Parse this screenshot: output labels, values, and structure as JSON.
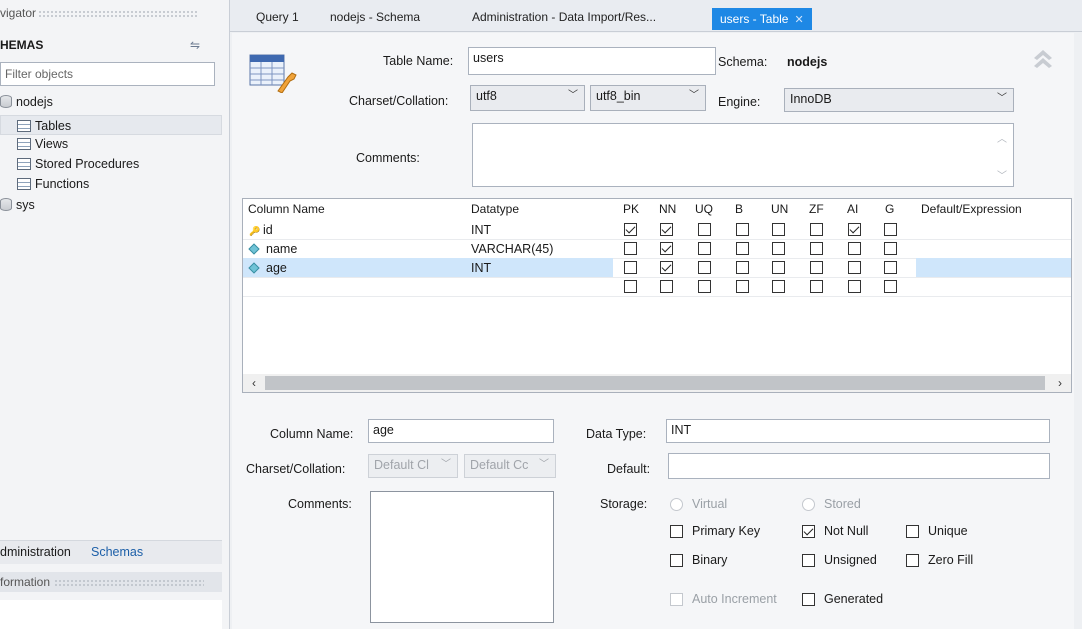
{
  "navigator": {
    "header": "vigator",
    "schemas_title": "HEMAS",
    "filter_placeholder": "Filter objects",
    "tree": [
      {
        "label": "nodejs",
        "type": "db"
      },
      {
        "label": "Tables",
        "type": "table"
      },
      {
        "label": "Views",
        "type": "table"
      },
      {
        "label": "Stored Procedures",
        "type": "table"
      },
      {
        "label": "Functions",
        "type": "table"
      },
      {
        "label": "sys",
        "type": "db"
      }
    ],
    "bottom_tabs": [
      "dministration",
      "Schemas"
    ],
    "info_header": "formation"
  },
  "tabs": [
    {
      "label": "Query 1"
    },
    {
      "label": "nodejs - Schema"
    },
    {
      "label": "Administration - Data Import/Res..."
    },
    {
      "label": "users - Table"
    }
  ],
  "table_editor": {
    "table_name_label": "Table Name:",
    "table_name_value": "users",
    "schema_label": "Schema:",
    "schema_value": "nodejs",
    "charset_label": "Charset/Collation:",
    "charset_value": "utf8",
    "collation_value": "utf8_bin",
    "engine_label": "Engine:",
    "engine_value": "InnoDB",
    "comments_label": "Comments:"
  },
  "columns_grid": {
    "headers": [
      "Column Name",
      "Datatype",
      "PK",
      "NN",
      "UQ",
      "B",
      "UN",
      "ZF",
      "AI",
      "G",
      "Default/Expression"
    ],
    "rows": [
      {
        "name": "id",
        "datatype": "INT",
        "flags": [
          true,
          true,
          false,
          false,
          false,
          false,
          true,
          false
        ],
        "key": true
      },
      {
        "name": "name",
        "datatype": "VARCHAR(45)",
        "flags": [
          false,
          true,
          false,
          false,
          false,
          false,
          false,
          false
        ],
        "key": false
      },
      {
        "name": "age",
        "datatype": "INT",
        "flags": [
          false,
          true,
          false,
          false,
          false,
          false,
          false,
          false
        ],
        "key": false
      },
      {
        "name": "",
        "datatype": "",
        "flags": [
          false,
          false,
          false,
          false,
          false,
          false,
          false,
          false
        ],
        "key": false
      }
    ]
  },
  "column_detail": {
    "column_name_label": "Column Name:",
    "column_name_value": "age",
    "data_type_label": "Data Type:",
    "data_type_value": "INT",
    "charset_label": "Charset/Collation:",
    "charset_value": "Default Cl",
    "collation_value": "Default Cc",
    "default_label": "Default:",
    "comments_label": "Comments:",
    "storage_label": "Storage:",
    "virtual_label": "Virtual",
    "stored_label": "Stored",
    "primary_key_label": "Primary Key",
    "not_null_label": "Not Null",
    "unique_label": "Unique",
    "binary_label": "Binary",
    "unsigned_label": "Unsigned",
    "zero_fill_label": "Zero Fill",
    "auto_increment_label": "Auto Increment",
    "generated_label": "Generated"
  },
  "colors": {
    "accent": "#1e88e5",
    "selection": "#cfe6fb"
  }
}
